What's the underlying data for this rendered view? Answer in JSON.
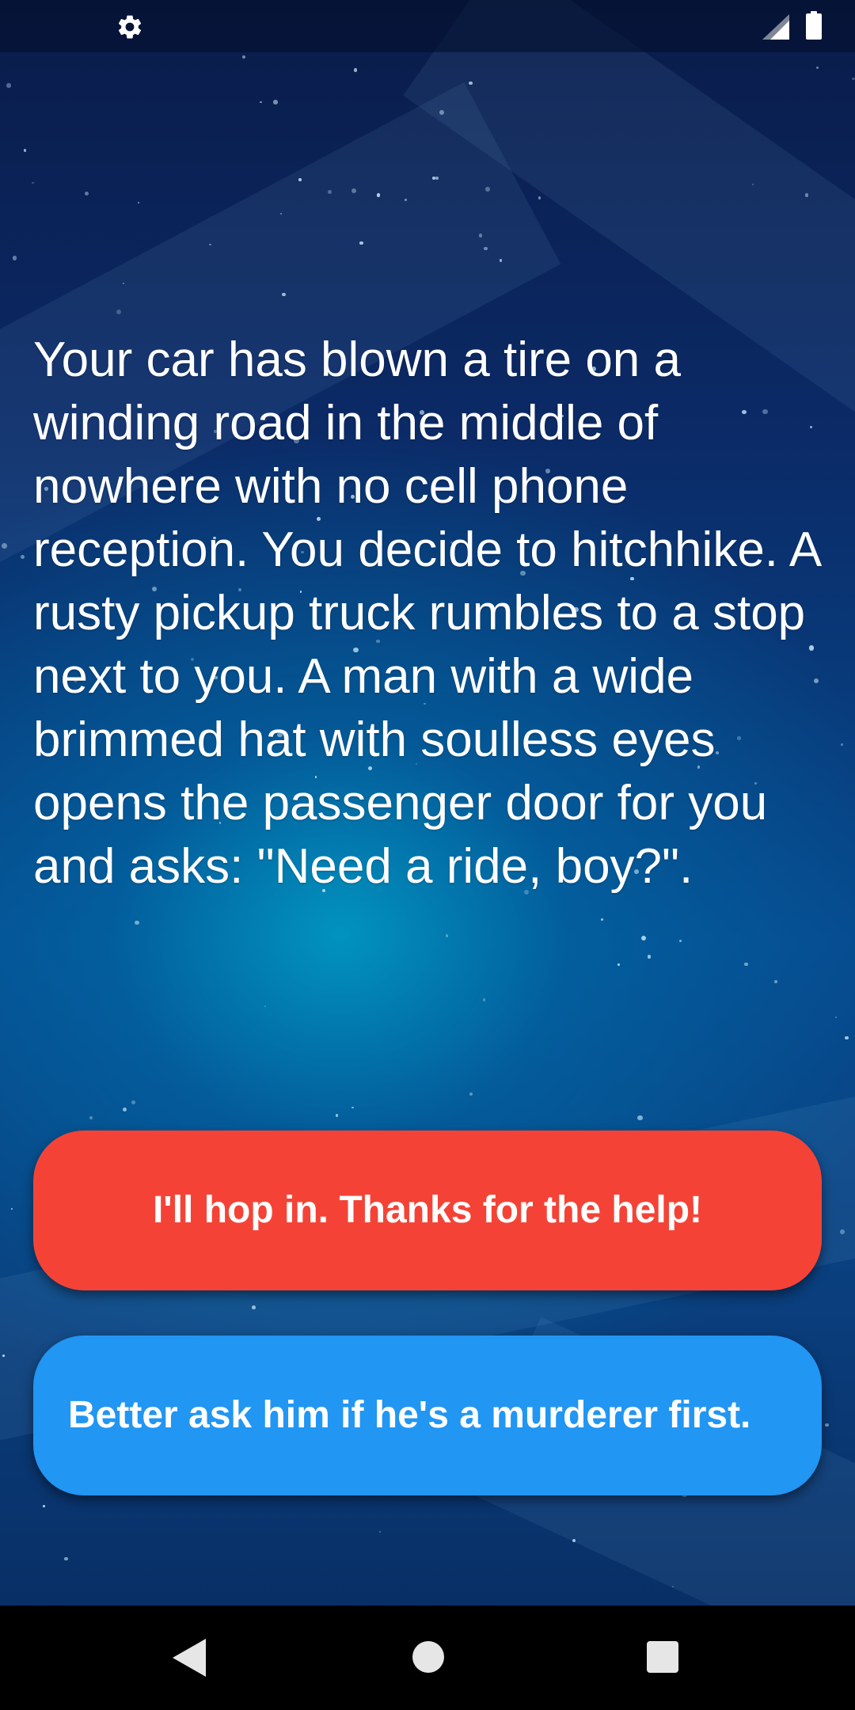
{
  "status_bar": {
    "left_icon": "gear-icon",
    "right_icons": [
      "signal-icon",
      "battery-icon"
    ]
  },
  "story": {
    "text": "Your car has blown a tire on a winding road in the middle of nowhere with no cell phone reception. You decide to hitchhike. A rusty pickup truck rumbles to a stop next to you. A man with a wide brimmed hat with soulless eyes opens the passenger door for you and asks: \"Need a ride, boy?\"."
  },
  "choices": [
    {
      "label": "I'll hop in. Thanks for the help!",
      "color": "#f44336"
    },
    {
      "label": "Better ask him if he's a murderer first.",
      "color": "#2196f3"
    }
  ],
  "nav_bar": {
    "icons": [
      "back-icon",
      "home-icon",
      "overview-icon"
    ]
  }
}
